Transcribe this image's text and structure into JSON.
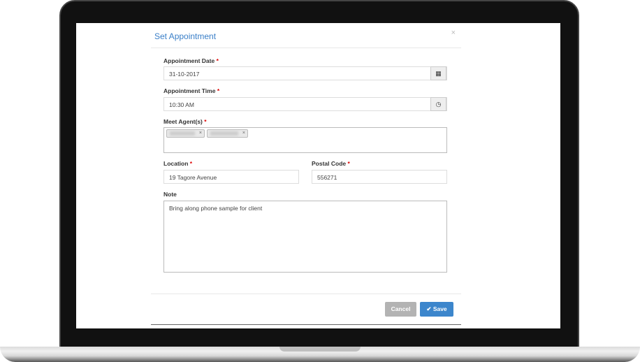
{
  "modal": {
    "title": "Set Appointment",
    "close": "×"
  },
  "fields": {
    "date": {
      "label": "Appointment Date",
      "required": "*",
      "value": "31-10-2017"
    },
    "time": {
      "label": "Appointment Time",
      "required": "*",
      "value": "10:30 AM"
    },
    "agents": {
      "label": "Meet Agent(s)",
      "required": "*",
      "tag_remove": "×"
    },
    "location": {
      "label": "Location",
      "required": "*",
      "value": "19 Tagore Avenue"
    },
    "postal": {
      "label": "Postal Code",
      "required": "*",
      "value": "556271"
    },
    "note": {
      "label": "Note",
      "value": "Bring along phone sample for client"
    }
  },
  "buttons": {
    "cancel": "Cancel",
    "save": "Save",
    "save_icon": "✔"
  },
  "colors": {
    "accent": "#3a7fc8",
    "cancel": "#b3b3b3",
    "save": "#3c86cc"
  }
}
